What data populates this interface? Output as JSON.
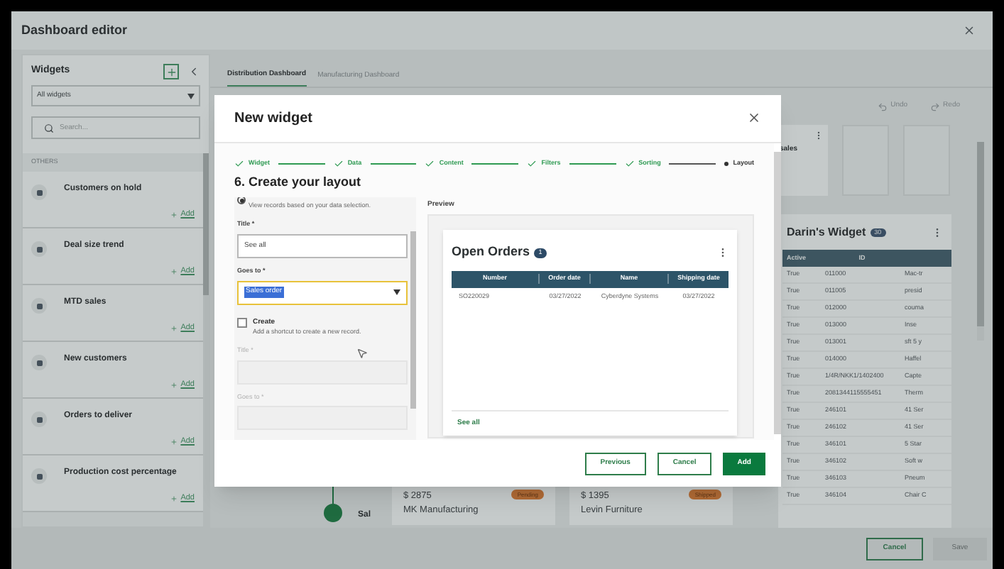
{
  "window": {
    "title": "Dashboard editor"
  },
  "sidebar": {
    "title": "Widgets",
    "filter": "All widgets",
    "search": {
      "placeholder": "Search..."
    },
    "section": "OTHERS",
    "items": [
      {
        "title": "Customers on hold",
        "action": "Add"
      },
      {
        "title": "Deal size trend",
        "action": "Add"
      },
      {
        "title": "MTD sales",
        "action": "Add"
      },
      {
        "title": "New customers",
        "action": "Add"
      },
      {
        "title": "Orders to deliver",
        "action": "Add"
      },
      {
        "title": "Production cost percentage",
        "action": "Add"
      }
    ]
  },
  "tabs": [
    {
      "label": "Distribution Dashboard",
      "selected": true
    },
    {
      "label": "Manufacturing Dashboard",
      "selected": false
    }
  ],
  "toolbar": {
    "undo": "Undo",
    "redo": "Redo"
  },
  "sales_card": {
    "title": "sales"
  },
  "darins_widget": {
    "title": "Darin's Widget",
    "count": "30",
    "columns": [
      "Active",
      "ID"
    ],
    "rows": [
      [
        "True",
        "011000",
        "Mac-tr"
      ],
      [
        "True",
        "011005",
        "presid"
      ],
      [
        "True",
        "012000",
        "couma"
      ],
      [
        "True",
        "013000",
        "Inse"
      ],
      [
        "True",
        "013001",
        "sft 5 y"
      ],
      [
        "True",
        "014000",
        "Haffel"
      ],
      [
        "True",
        "1/4R/NKK1/1402400",
        "Capte"
      ],
      [
        "True",
        "2081344115555451",
        "Therm"
      ],
      [
        "True",
        "246101",
        "41 Ser"
      ],
      [
        "True",
        "246102",
        "41 Ser"
      ],
      [
        "True",
        "346101",
        "5 Star"
      ],
      [
        "True",
        "346102",
        "Soft w"
      ],
      [
        "True",
        "346103",
        "Pneum"
      ],
      [
        "True",
        "346104",
        "Chair C"
      ]
    ]
  },
  "timeline": {
    "label": "Sal"
  },
  "orders": [
    {
      "amount": "$ 2875",
      "customer": "MK Manufacturing",
      "status": "Pending"
    },
    {
      "amount": "$ 1395",
      "customer": "Levin Furniture",
      "status": "Shipped"
    }
  ],
  "footer_buttons": [
    {
      "label": "Cancel",
      "disabled": false
    },
    {
      "label": "Save",
      "disabled": true
    }
  ],
  "modal": {
    "title": "New widget",
    "heading": "6. Create your layout",
    "steps": [
      {
        "label": "Widget",
        "completed": true
      },
      {
        "label": "Data",
        "completed": true
      },
      {
        "label": "Content",
        "completed": true
      },
      {
        "label": "Filters",
        "completed": true
      },
      {
        "label": "Sorting",
        "completed": true
      },
      {
        "label": "Layout",
        "completed": false
      }
    ],
    "form": [
      {
        "kind": "radio",
        "description": "View records based on your data selection.",
        "selected": true
      },
      {
        "kind": "text",
        "label": "Title *",
        "value": "See all",
        "disabled": false,
        "focused": false
      },
      {
        "kind": "select",
        "label": "Goes to *",
        "value": "Sales order",
        "disabled": false,
        "focused": true
      },
      {
        "kind": "checkbox",
        "label": "Create",
        "description": "Add a shortcut to create a new record.",
        "checked": false
      },
      {
        "kind": "text",
        "label": "Title *",
        "disabled": true,
        "focused": false
      },
      {
        "kind": "text",
        "label": "Goes to *",
        "disabled": true,
        "focused": false
      }
    ],
    "preview": {
      "label": "Preview",
      "widget": {
        "title": "Open Orders",
        "count": "1",
        "columns": [
          "Number",
          "Order date",
          "Name",
          "Shipping date"
        ],
        "rows": [
          [
            "SO220029",
            "03/27/2022",
            "Cyberdyne Systems",
            "03/27/2022"
          ]
        ],
        "link": "See all"
      }
    },
    "buttons": [
      {
        "label": "Previous",
        "kind": "secondary"
      },
      {
        "label": "Cancel",
        "kind": "secondary"
      },
      {
        "label": "Add",
        "kind": "primary"
      }
    ]
  }
}
